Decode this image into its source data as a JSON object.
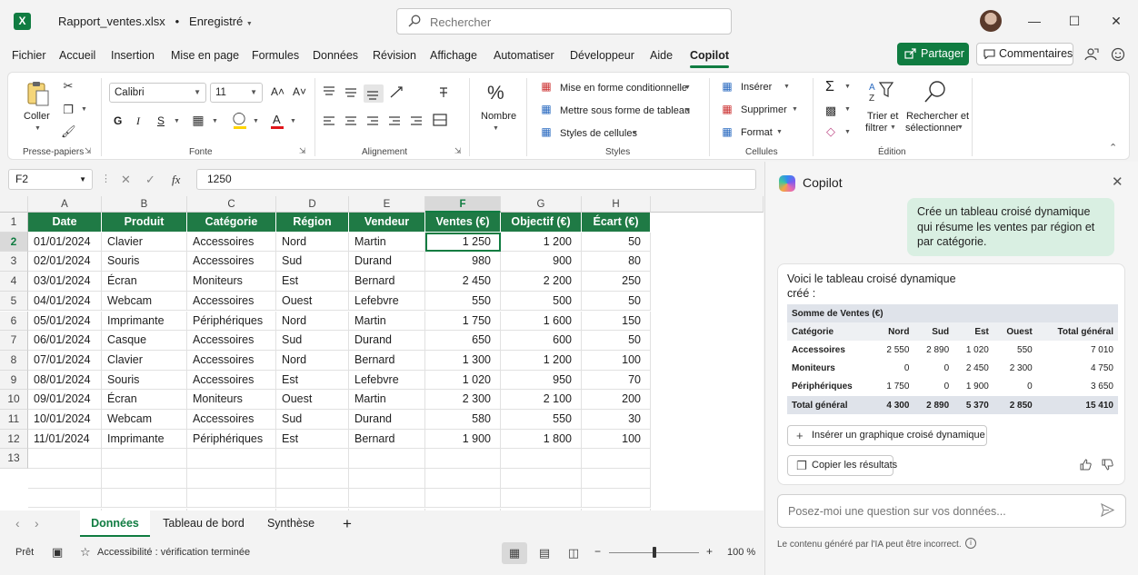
{
  "titlebar": {
    "app_icon": "excel-logo",
    "app_letter": "X",
    "filename": "Rapport_ventes.xlsx",
    "separator": "•",
    "save_status": "Enregistré",
    "search_placeholder": "Rechercher",
    "minimize": "—",
    "maximize": "☐",
    "close": "✕"
  },
  "menu": {
    "tabs": [
      "Fichier",
      "Accueil",
      "Insertion",
      "Mise en page",
      "Formules",
      "Données",
      "Révision",
      "Affichage",
      "Automatiser",
      "Développeur",
      "Aide",
      "Copilot"
    ],
    "active_tab": "Copilot",
    "share_label": "Partager",
    "comments_label": "Commentaires"
  },
  "ribbon": {
    "clipboard": {
      "paste_label": "Coller",
      "group_label": "Presse-papiers"
    },
    "font": {
      "font_name": "Calibri",
      "font_size": "11",
      "grow": "A˄",
      "shrink": "A˅",
      "bold": "G",
      "italic": "I",
      "underline": "S",
      "group_label": "Fonte"
    },
    "alignment": {
      "group_label": "Alignement"
    },
    "number": {
      "label": "Nombre",
      "symbol": "%"
    },
    "styles": {
      "conditional": "Mise en forme conditionnelle",
      "as_table": "Mettre sous forme de tableau",
      "cell_styles": "Styles de cellules",
      "group_label": "Styles"
    },
    "cells": {
      "insert": "Insérer",
      "delete": "Supprimer",
      "format": "Format",
      "group_label": "Cellules"
    },
    "editing": {
      "sum": "Σ",
      "sort_label_1": "Trier et",
      "sort_label_2": "filtrer",
      "find_label_1": "Rechercher et",
      "find_label_2": "sélectionner",
      "group_label": "Édition"
    }
  },
  "formula_bar": {
    "name_box": "F2",
    "cancel": "✕",
    "enter": "✓",
    "fx": "fx",
    "value": "1250"
  },
  "grid": {
    "columns": [
      "A",
      "B",
      "C",
      "D",
      "E",
      "F",
      "G",
      "H"
    ],
    "selected_column": "F",
    "selected_row": "2",
    "headers": [
      "Date",
      "Produit",
      "Catégorie",
      "Région",
      "Vendeur",
      "Ventes (€)",
      "Objectif (€)",
      "Écart (€)"
    ],
    "rows": [
      [
        "01/01/2024",
        "Clavier",
        "Accessoires",
        "Nord",
        "Martin",
        "1 250",
        "1 200",
        "50"
      ],
      [
        "02/01/2024",
        "Souris",
        "Accessoires",
        "Sud",
        "Durand",
        "980",
        "900",
        "80"
      ],
      [
        "03/01/2024",
        "Écran",
        "Moniteurs",
        "Est",
        "Bernard",
        "2 450",
        "2 200",
        "250"
      ],
      [
        "04/01/2024",
        "Webcam",
        "Accessoires",
        "Ouest",
        "Lefebvre",
        "550",
        "500",
        "50"
      ],
      [
        "05/01/2024",
        "Imprimante",
        "Périphériques",
        "Nord",
        "Martin",
        "1 750",
        "1 600",
        "150"
      ],
      [
        "06/01/2024",
        "Casque",
        "Accessoires",
        "Sud",
        "Durand",
        "650",
        "600",
        "50"
      ],
      [
        "07/01/2024",
        "Clavier",
        "Accessoires",
        "Nord",
        "Bernard",
        "1 300",
        "1 200",
        "100"
      ],
      [
        "08/01/2024",
        "Souris",
        "Accessoires",
        "Est",
        "Lefebvre",
        "1 020",
        "950",
        "70"
      ],
      [
        "09/01/2024",
        "Écran",
        "Moniteurs",
        "Ouest",
        "Martin",
        "2 300",
        "2 100",
        "200"
      ],
      [
        "10/01/2024",
        "Webcam",
        "Accessoires",
        "Sud",
        "Durand",
        "580",
        "550",
        "30"
      ],
      [
        "11/01/2024",
        "Imprimante",
        "Périphériques",
        "Est",
        "Bernard",
        "1 900",
        "1 800",
        "100"
      ]
    ],
    "row_numbers": [
      "1",
      "2",
      "3",
      "4",
      "5",
      "6",
      "7",
      "8",
      "9",
      "10",
      "11",
      "12",
      "13"
    ]
  },
  "sheets": {
    "tabs": [
      "Données",
      "Tableau de bord",
      "Synthèse"
    ],
    "active": "Données",
    "add": "+"
  },
  "status": {
    "ready": "Prêt",
    "accessibility": "Accessibilité : vérification terminée",
    "zoom_minus": "−",
    "zoom_plus": "+",
    "zoom": "100 %",
    "zoom_level": 0.5
  },
  "copilot": {
    "title": "Copilot",
    "close": "✕",
    "user_message": "Crée un tableau croisé dynamique qui résume les ventes par région et par catégorie.",
    "response_intro": "Voici le tableau croisé dynamique créé :",
    "pivot": {
      "title": "Somme de Ventes (€)",
      "columns": [
        "Catégorie",
        "Nord",
        "Sud",
        "Est",
        "Ouest",
        "Total général"
      ],
      "rows": [
        [
          "Accessoires",
          "2 550",
          "2 890",
          "1 020",
          "550",
          "7 010"
        ],
        [
          "Moniteurs",
          "0",
          "0",
          "2 450",
          "2 300",
          "4 750"
        ],
        [
          "Périphériques",
          "1 750",
          "0",
          "1 900",
          "0",
          "3 650"
        ]
      ],
      "total": [
        "Total général",
        "4 300",
        "2 890",
        "5 370",
        "2 850",
        "15 410"
      ]
    },
    "insert_chart": "Insérer un graphique croisé dynamique",
    "copy_results": "Copier les résultats",
    "ask_placeholder": "Posez-moi une question sur vos données...",
    "disclaimer": "Le contenu généré par l'IA peut être incorrect.",
    "info": "i"
  }
}
